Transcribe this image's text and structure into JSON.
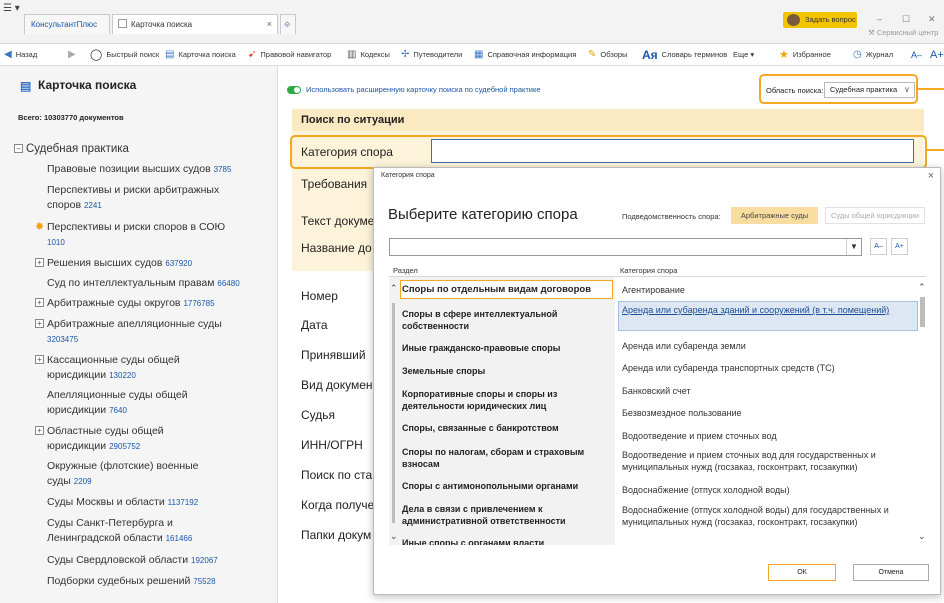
{
  "tabs": [
    {
      "label": "КонсультантПлюс"
    },
    {
      "label": "Карточка поиска"
    }
  ],
  "titlebar": {
    "ask_button": "Задать вопрос",
    "service_center": "Сервисный центр"
  },
  "toolbar": {
    "back": "Назад",
    "quick_search": "Быстрый поиск",
    "search_card": "Карточка поиска",
    "legal_navigator": "Правовой навигатор",
    "codes": "Кодексы",
    "guides": "Путеводители",
    "reference": "Справочная информация",
    "reviews": "Обзоры",
    "dictionary": "Словарь терминов",
    "more": "Еще",
    "favorites": "Избранное",
    "journal": "Журнал",
    "font_small": "A–",
    "font_large": "A+"
  },
  "sidebar": {
    "title": "Карточка поиска",
    "total": "Всего: 10303770 документов",
    "items": [
      {
        "label": "Судебная практика",
        "count": ""
      },
      {
        "label": "Правовые позиции высших судов",
        "count": "3785"
      },
      {
        "label": "Перспективы и риски арбитражных споров",
        "count": "2241"
      },
      {
        "label": "Перспективы и риски споров в СОЮ",
        "count": "1010"
      },
      {
        "label": "Решения высших судов",
        "count": "637920"
      },
      {
        "label": "Суд по интеллектуальным правам",
        "count": "66480"
      },
      {
        "label": "Арбитражные суды округов",
        "count": "1776785"
      },
      {
        "label": "Арбитражные апелляционные суды",
        "count": "3203475"
      },
      {
        "label": "Кассационные суды общей юрисдикции",
        "count": "130220"
      },
      {
        "label": "Апелляционные суды общей юрисдикции",
        "count": "7640"
      },
      {
        "label": "Областные суды общей юрисдикции",
        "count": "2905752"
      },
      {
        "label": "Окружные (флотские) военные суды",
        "count": "2209"
      },
      {
        "label": "Суды Москвы и области",
        "count": "1137192"
      },
      {
        "label": "Суды Санкт-Петербурга и Ленинградской области",
        "count": "161466"
      },
      {
        "label": "Суды Свердловской области",
        "count": "192067"
      },
      {
        "label": "Подборки судебных решений",
        "count": "75528"
      }
    ]
  },
  "main": {
    "extended_card_toggle": "Использовать расширенную карточку поиска по судебной практике",
    "search_area_label": "Область поиска:",
    "search_area_value": "Судебная практика",
    "section_title": "Поиск по ситуации",
    "fields": {
      "category": "Категория спора",
      "requirements": "Требования",
      "text": "Текст докуме",
      "name": "Название до",
      "number": "Номер",
      "date": "Дата",
      "adopted": "Принявший",
      "doc_type": "Вид докумен",
      "judge": "Судья",
      "inn": "ИНН/ОГРН",
      "search_by": "Поиск по ста",
      "received": "Когда получе",
      "folders": "Папки докум"
    }
  },
  "dialog": {
    "caption": "Категория спора",
    "title": "Выберите категорию спора",
    "jurisdiction_label": "Подведомственность спора:",
    "jurisdiction_arb": "Арбитражные суды",
    "jurisdiction_general": "Суды общей юрисдикции",
    "font_minus": "A–",
    "font_plus": "A+",
    "col_left": "Раздел",
    "col_right": "Категория спора",
    "sections": [
      "Споры по отдельным видам договоров",
      "Споры в сфере интеллектуальной собственности",
      "Иные гражданско-правовые споры",
      "Земельные споры",
      "Корпоративные споры и споры из деятельности юридических лиц",
      "Споры, связанные с банкротством",
      "Споры по налогам, сборам и страховым взносам",
      "Споры с антимонопольными органами",
      "Дела в связи с привлечением к административной ответственности",
      "Иные споры с органами власти"
    ],
    "categories": [
      "Агентирование",
      "Аренда или субаренда зданий и сооружений (в т.ч. помещений)",
      "Аренда или субаренда земли",
      "Аренда или субаренда транспортных средств (ТС)",
      "Банковский счет",
      "Безвозмездное пользование",
      "Водоотведение и прием сточных вод",
      "Водоотведение и прием сточных вод для государственных и муниципальных нужд (госзаказ, госконтракт, госзакупки)",
      "Водоснабжение (отпуск холодной воды)",
      "Водоснабжение (отпуск холодной воды) для государственных и муниципальных нужд (госзаказ, госконтракт, госзакупки)"
    ],
    "ok": "ОК",
    "cancel": "Отмена"
  },
  "colors": {
    "accent_orange": "#f5a623",
    "link_blue": "#1b56a8",
    "selection_blue": "#dce7f3",
    "toggle_green": "#2eaa45",
    "form_bg": "#fdf3da"
  }
}
